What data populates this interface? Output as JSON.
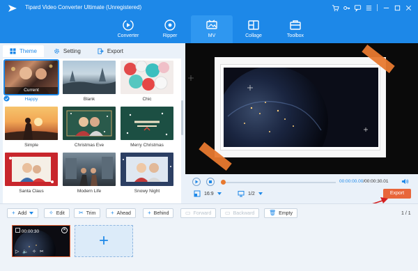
{
  "app": {
    "title": "Tipard Video Converter Ultimate (Unregistered)",
    "accent_color": "#1d88e8",
    "window_icons": [
      "cart-icon",
      "key-icon",
      "chat-icon",
      "menu-icon",
      "minimize-icon",
      "maximize-icon",
      "close-icon"
    ]
  },
  "nav": [
    {
      "label": "Converter",
      "icon": "converter-icon"
    },
    {
      "label": "Ripper",
      "icon": "ripper-icon"
    },
    {
      "label": "MV",
      "icon": "mv-icon",
      "active": true
    },
    {
      "label": "Collage",
      "icon": "collage-icon"
    },
    {
      "label": "Toolbox",
      "icon": "toolbox-icon"
    }
  ],
  "tabs": [
    {
      "label": "Theme",
      "icon": "grid-icon",
      "active": true
    },
    {
      "label": "Setting",
      "icon": "gear-icon"
    },
    {
      "label": "Export",
      "icon": "export-icon"
    }
  ],
  "themes": [
    {
      "label": "Happy",
      "current_tag": "Current",
      "selected": true
    },
    {
      "label": "Blank"
    },
    {
      "label": "Chic"
    },
    {
      "label": "Simple"
    },
    {
      "label": "Christmas Eve"
    },
    {
      "label": "Merry Christmas"
    },
    {
      "label": "Santa Claus"
    },
    {
      "label": "Modern Life"
    },
    {
      "label": "Snowy Night"
    }
  ],
  "player": {
    "current_time": "00:00:00.00",
    "total_time": "/00:00:30.01",
    "aspect_ratio": "16:9",
    "page": "1/2",
    "export_label": "Export",
    "export_color": "#e8663a"
  },
  "toolbar": {
    "add": "Add",
    "edit": "Edit",
    "trim": "Trim",
    "ahead": "Ahead",
    "behind": "Behind",
    "forward": "Forward",
    "backward": "Backward",
    "empty": "Empty",
    "page_count": "1 / 1"
  },
  "timeline": {
    "clip_duration": "00:00:30",
    "add_symbol": "+"
  }
}
